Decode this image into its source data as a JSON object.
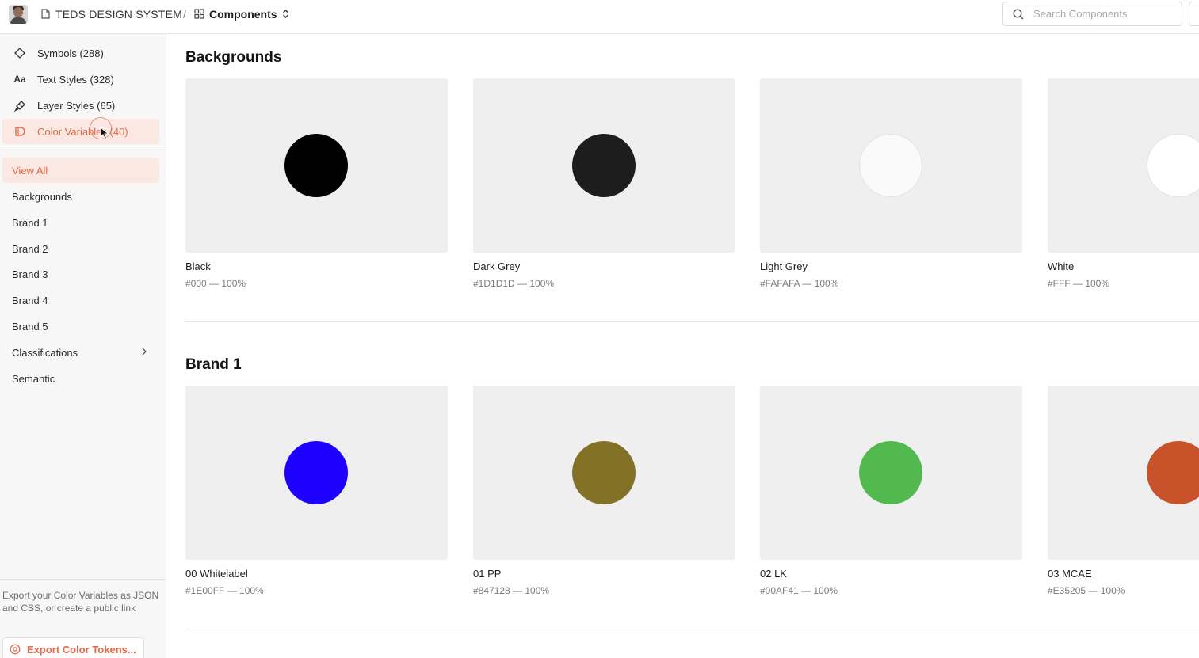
{
  "header": {
    "file_name": "TEDS DESIGN SYSTEM",
    "separator": "/",
    "section": "Components",
    "search_placeholder": "Search Components"
  },
  "sidebar": {
    "nav": [
      {
        "icon": "diamond-icon",
        "label": "Symbols (288)"
      },
      {
        "icon": "text-styles-icon",
        "glyph": "Aa",
        "label": "Text Styles (328)"
      },
      {
        "icon": "paint-brush-icon",
        "label": "Layer Styles (65)"
      },
      {
        "icon": "color-bucket-icon",
        "label": "Color Variables (40)",
        "active": true
      }
    ],
    "groups": [
      {
        "label": "View All",
        "active": true
      },
      {
        "label": "Backgrounds"
      },
      {
        "label": "Brand 1"
      },
      {
        "label": "Brand 2"
      },
      {
        "label": "Brand 3"
      },
      {
        "label": "Brand 4"
      },
      {
        "label": "Brand 5"
      },
      {
        "label": "Classifications",
        "has_children": true
      },
      {
        "label": "Semantic"
      }
    ],
    "export_description": "Export your Color Variables as JSON and CSS, or create a public link",
    "export_button": "Export Color Tokens..."
  },
  "sections": [
    {
      "title": "Backgrounds",
      "colors": [
        {
          "name": "Black",
          "meta": "#000 — 100%",
          "color": "#000000"
        },
        {
          "name": "Dark Grey",
          "meta": "#1D1D1D — 100%",
          "color": "#1D1D1D"
        },
        {
          "name": "Light Grey",
          "meta": "#FAFAFA — 100%",
          "color": "#FAFAFA"
        },
        {
          "name": "White",
          "meta": "#FFF — 100%",
          "color": "#FFFFFF"
        }
      ]
    },
    {
      "title": "Brand 1",
      "colors": [
        {
          "name": "00 Whitelabel",
          "meta": "#1E00FF — 100%",
          "color": "#1E00FF"
        },
        {
          "name": "01 PP",
          "meta": "#847128 — 100%",
          "color": "#847128"
        },
        {
          "name": "02 LK",
          "meta": "#00AF41 — 100%",
          "color": "#52B94F"
        },
        {
          "name": "03 MCAE",
          "meta": "#E35205 — 100%",
          "color": "#C8522A"
        }
      ]
    }
  ],
  "accent_color": "#E26A4A"
}
